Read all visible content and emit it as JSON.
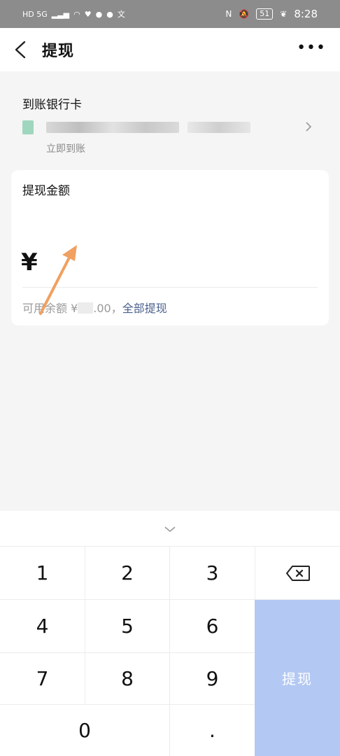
{
  "status_bar": {
    "left_icons": "HD 5G",
    "battery": "51",
    "time": "8:28"
  },
  "nav": {
    "title": "提现"
  },
  "bank": {
    "label": "到账银行卡",
    "arrival": "立即到账"
  },
  "amount": {
    "label": "提现金额",
    "currency": "¥",
    "available_prefix": "可用余额 ¥",
    "available_suffix": ".00，",
    "withdraw_all": "全部提现"
  },
  "keypad": {
    "keys": [
      "1",
      "2",
      "3",
      "4",
      "5",
      "6",
      "7",
      "8",
      "9",
      "0",
      "."
    ],
    "submit_label": "提现"
  },
  "colors": {
    "submit_bg": "#b3c9f3",
    "link": "#4a5f8c",
    "annotation_arrow": "#f0a060"
  }
}
